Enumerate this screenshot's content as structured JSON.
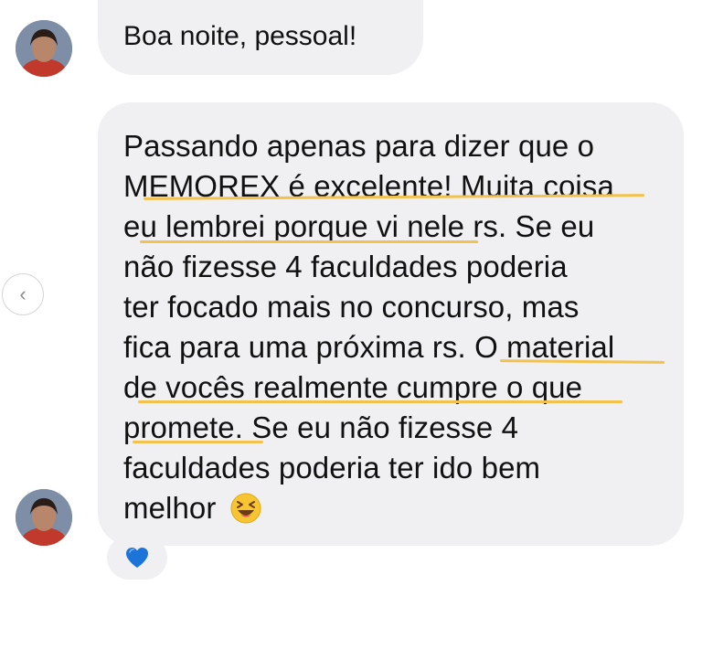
{
  "conversation": {
    "greeting": "Boa noite, pessoal!",
    "main_lines": [
      "Passando apenas para dizer que o",
      "MEMOREX é excelente! Muita coisa",
      "eu lembrei porque vi nele rs. Se eu",
      "não fizesse 4 faculdades poderia",
      "ter focado mais no concurso, mas",
      "fica para uma próxima rs. O material",
      "de vocês realmente cumpre o que",
      "promete. Se eu não fizesse 4",
      "faculdades poderia ter ido bem",
      "melhor"
    ],
    "emoji": "laughing-squint-emoji",
    "reaction": "blue-heart-icon"
  },
  "nav": {
    "back_icon": "chevron-left-icon",
    "back_glyph": "‹"
  },
  "colors": {
    "bubble": "#f0f0f3",
    "highlight_underline": "#f2c14e",
    "reaction_heart": "#1d74d8"
  }
}
